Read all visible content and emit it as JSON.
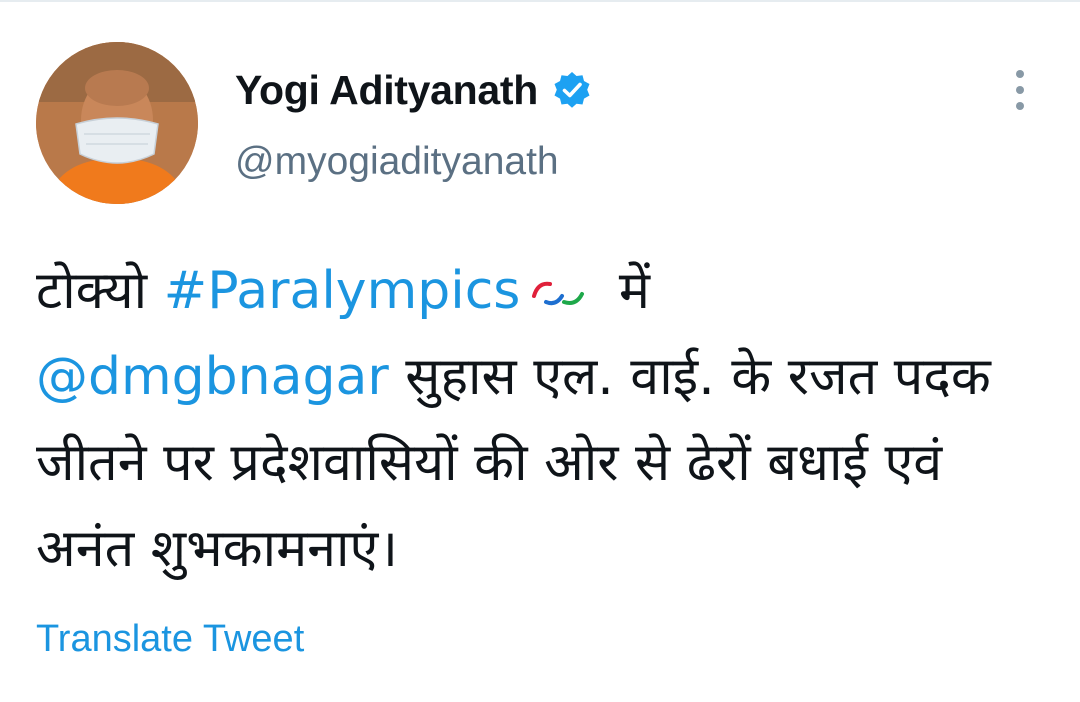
{
  "tweet": {
    "author": {
      "display_name": "Yogi Adityanath",
      "handle": "@myogiadityanath",
      "verified": true,
      "avatar_icon": "profile-photo"
    },
    "menu_icon": "more-vertical-icon",
    "body": {
      "text_1": "टोक्यो ",
      "hashtag": "#Paralympics",
      "emoji_icon": "paralympics-agitos-icon",
      "text_2": " में",
      "mention": "@dmgbnagar",
      "text_3": " सुहास एल. वाई. के रजत पदक जीतने पर प्रदेशवासियों की ओर से ढेरों बधाई एवं अनंत शुभकामनाएं।"
    },
    "translate_label": "Translate Tweet"
  },
  "colors": {
    "link": "#1b95e0",
    "text": "#0f1419",
    "secondary": "#5b7083",
    "verified": "#1da1f2"
  }
}
